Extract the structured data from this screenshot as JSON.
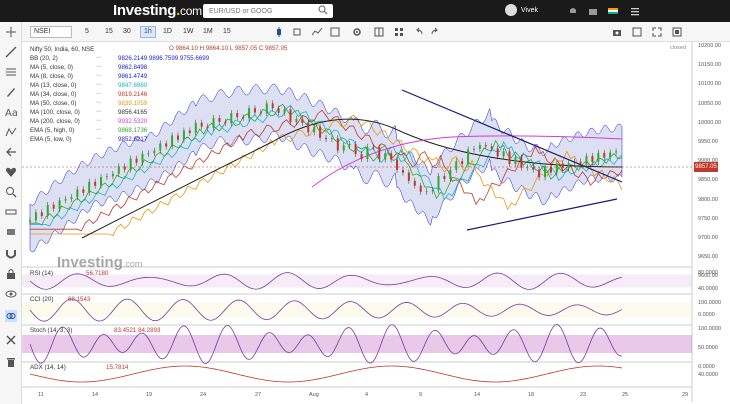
{
  "header": {
    "logo": "Investing",
    "logo_dot": ".",
    "logo_suffix": "com",
    "search_placeholder": "EUR/USD or GOOG",
    "user_name": "Vivek"
  },
  "toolbar": {
    "symbol": "NSEI",
    "timeframes": [
      "5",
      "15",
      "30",
      "1h",
      "1D",
      "1W",
      "1M",
      "15"
    ],
    "active_timeframe": "1h"
  },
  "chart": {
    "title": "Nifty 50, India, 60, NSE",
    "ohlc": "O 9864.10  H 9864.10  L 9857.05  C 9857.05",
    "status": "closed",
    "last_price": "9857.05",
    "watermark": "Investing",
    "watermark_suffix": ".com",
    "indicators": [
      {
        "name": "BB (20, 2)",
        "values": "9826.2149  9896.7599  9755.6699",
        "color": "#1b1bd1"
      },
      {
        "name": "MA (5, close, 0)",
        "values": "9862.8498",
        "color": "#1b1bd1"
      },
      {
        "name": "MA (8, close, 0)",
        "values": "9861.4749",
        "color": "#1b1bd1"
      },
      {
        "name": "MA (13, close, 0)",
        "values": "9847.6960",
        "color": "#17b5d4"
      },
      {
        "name": "MA (34, close, 0)",
        "values": "9819.2146",
        "color": "#c0392b"
      },
      {
        "name": "MA (50, close, 0)",
        "values": "9839.1059",
        "color": "#e39a0c"
      },
      {
        "name": "MA (100, close, 0)",
        "values": "9856.4165",
        "color": "#333333"
      },
      {
        "name": "MA (200, close, 0)",
        "values": "9932.5320",
        "color": "#d63ad6"
      },
      {
        "name": "EMA (5, high, 0)",
        "values": "9868.1736",
        "color": "#2eaa2e"
      },
      {
        "name": "EMA (5, low, 0)",
        "values": "9852.6217",
        "color": "#1b1bd1"
      }
    ],
    "y_axis": [
      "10200.00",
      "10150.00",
      "10100.00",
      "10050.00",
      "10000.00",
      "9950.00",
      "9900.00",
      "9850.00",
      "9800.00",
      "9750.00",
      "9700.00",
      "9650.00",
      "9600.00"
    ],
    "x_axis": [
      "11",
      "14",
      "19",
      "24",
      "27",
      "Aug",
      "4",
      "9",
      "14",
      "18",
      "23",
      "25",
      "29"
    ],
    "subpanels": [
      {
        "label": "RSI (14)",
        "value": "56.7180",
        "axis": [
          "80.0000",
          "40.0000"
        ]
      },
      {
        "label": "CCI (20)",
        "value": "68.1543",
        "axis": [
          "100.0000",
          "0.0000"
        ]
      },
      {
        "label": "Stoch (14, 3, 3)",
        "value": "83.4521  84.2893",
        "axis": [
          "100.0000",
          "50.0000",
          "0.0000"
        ]
      },
      {
        "label": "ADX (14, 14)",
        "value": "15.7814",
        "axis": [
          "40.0000"
        ]
      }
    ]
  }
}
